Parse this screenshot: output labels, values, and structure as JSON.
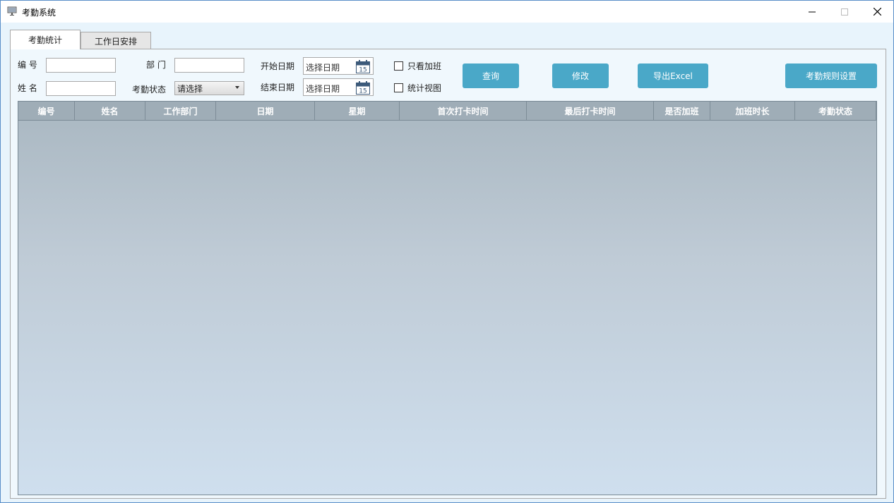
{
  "window": {
    "title": "考勤系统"
  },
  "tabs": [
    {
      "label": "考勤统计"
    },
    {
      "label": "工作日安排"
    }
  ],
  "filters": {
    "id_label": "编 号",
    "name_label": "姓 名",
    "dept_label": "部 门",
    "status_label": "考勤状态",
    "status_value": "请选择",
    "start_label": "开始日期",
    "end_label": "结束日期",
    "start_placeholder": "选择日期",
    "end_placeholder": "选择日期",
    "calendar_day": "15",
    "overtime_only_label": "只看加班",
    "stats_view_label": "统计视图"
  },
  "buttons": {
    "query": "查询",
    "modify": "修改",
    "export": "导出Excel",
    "rules": "考勤规则设置"
  },
  "table": {
    "columns": [
      "编号",
      "姓名",
      "工作部门",
      "日期",
      "星期",
      "首次打卡时间",
      "最后打卡时间",
      "是否加班",
      "加班时长",
      "考勤状态"
    ],
    "rows": []
  },
  "colors": {
    "accent_button": "#4aa8c8",
    "header_bg": "#9fadb7"
  }
}
